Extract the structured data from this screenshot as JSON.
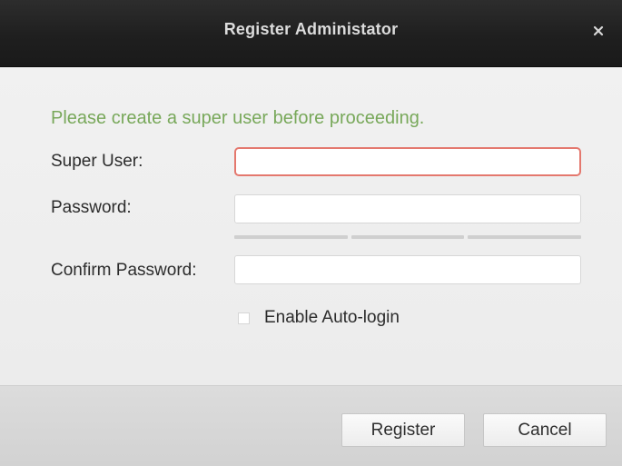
{
  "dialog": {
    "title": "Register Administator",
    "close_icon": "close-icon",
    "close_glyph": "×"
  },
  "form": {
    "prompt": "Please create a super user before proceeding.",
    "super_user": {
      "label": "Super User:",
      "value": "",
      "placeholder": ""
    },
    "password": {
      "label": "Password:",
      "value": "",
      "placeholder": ""
    },
    "confirm_password": {
      "label": "Confirm Password:",
      "value": "",
      "placeholder": ""
    },
    "auto_login": {
      "label": "Enable Auto-login",
      "checked": false
    }
  },
  "buttons": {
    "register": "Register",
    "cancel": "Cancel"
  },
  "colors": {
    "title_bar": "#1f1f1f",
    "prompt_green": "#78a85a",
    "focus_border": "#e4786e"
  }
}
